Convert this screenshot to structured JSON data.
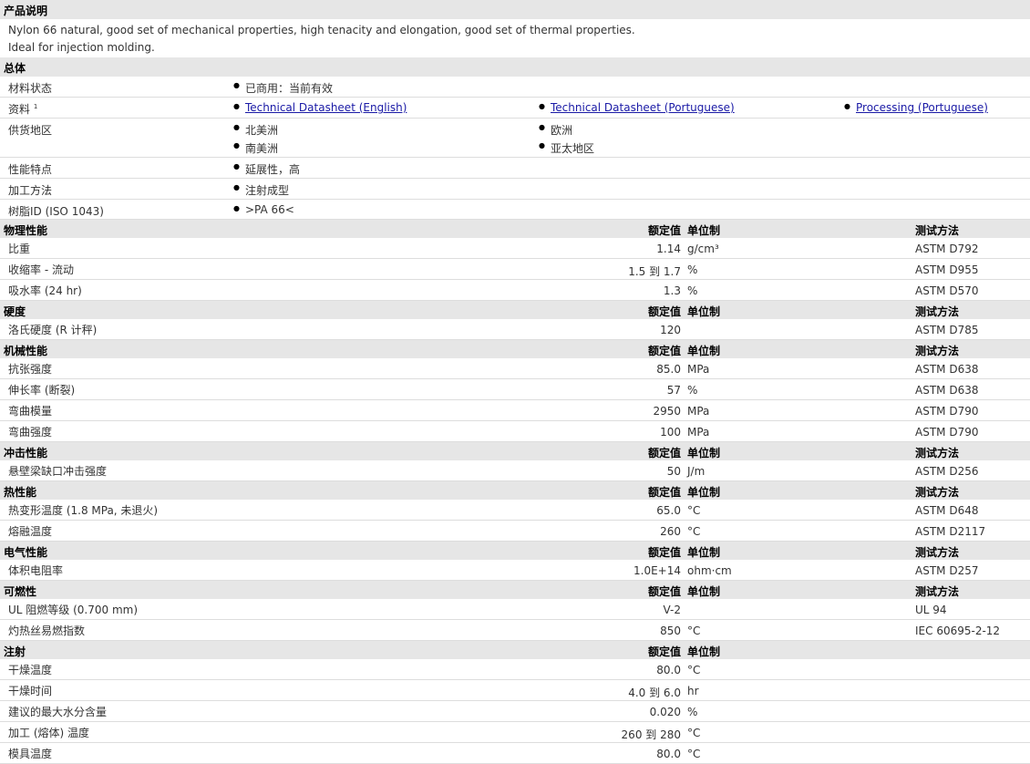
{
  "sections": {
    "desc": {
      "title": "产品说明",
      "lines": [
        "Nylon 66 natural, good set of mechanical properties, high tenacity and elongation, good set of thermal properties.",
        "Ideal for injection molding."
      ]
    },
    "general": {
      "title": "总体"
    },
    "physical": {
      "title": "物理性能"
    },
    "hardness": {
      "title": "硬度"
    },
    "mechanical": {
      "title": "机械性能"
    },
    "impact": {
      "title": "冲击性能"
    },
    "thermal": {
      "title": "热性能"
    },
    "electrical": {
      "title": "电气性能"
    },
    "flammability": {
      "title": "可燃性"
    },
    "injection": {
      "title": "注射"
    }
  },
  "headers": {
    "nominal": "额定值",
    "unit": "单位制",
    "method": "测试方法"
  },
  "general": {
    "status": {
      "label": "材料状态",
      "v1": "已商用：当前有效"
    },
    "docs": {
      "label": "资料",
      "sup": "1",
      "v1": "Technical Datasheet (English)",
      "v2": "Technical Datasheet (Portuguese)",
      "v3": "Processing (Portuguese)"
    },
    "avail": {
      "label": "供货地区",
      "v1": "北美洲",
      "v2": "欧洲",
      "v3": "南美洲",
      "v4": "亚太地区"
    },
    "features": {
      "label": "性能特点",
      "v1": "延展性，高"
    },
    "process": {
      "label": "加工方法",
      "v1": "注射成型"
    },
    "resin": {
      "label": "树脂ID (ISO 1043)",
      "v1": ">PA 66<"
    }
  },
  "physical": [
    {
      "label": "比重",
      "nominal": "1.14",
      "unit": "g/cm³",
      "method": "ASTM D792"
    },
    {
      "label": "收缩率 - 流动",
      "nominal": "1.5 到  1.7",
      "unit": "%",
      "method": "ASTM D955"
    },
    {
      "label": "吸水率 (24 hr)",
      "nominal": "1.3",
      "unit": "%",
      "method": "ASTM D570"
    }
  ],
  "hardness": [
    {
      "label": "洛氏硬度 (R 计秤)",
      "nominal": "120",
      "unit": "",
      "method": "ASTM D785"
    }
  ],
  "mechanical": [
    {
      "label": "抗张强度",
      "nominal": "85.0",
      "unit": "MPa",
      "method": "ASTM D638"
    },
    {
      "label": "伸长率 (断裂)",
      "nominal": "57",
      "unit": "%",
      "method": "ASTM D638"
    },
    {
      "label": "弯曲模量",
      "nominal": "2950",
      "unit": "MPa",
      "method": "ASTM D790"
    },
    {
      "label": "弯曲强度",
      "nominal": "100",
      "unit": "MPa",
      "method": "ASTM D790"
    }
  ],
  "impact": [
    {
      "label": "悬壁梁缺口冲击强度",
      "nominal": "50",
      "unit": "J/m",
      "method": "ASTM D256"
    }
  ],
  "thermal": [
    {
      "label": "热变形温度 (1.8 MPa, 未退火)",
      "nominal": "65.0",
      "unit": "°C",
      "method": "ASTM D648"
    },
    {
      "label": "熔融温度",
      "nominal": "260",
      "unit": "°C",
      "method": "ASTM D2117"
    }
  ],
  "electrical": [
    {
      "label": "体积电阻率",
      "nominal": "1.0E+14",
      "unit": "ohm·cm",
      "method": "ASTM D257"
    }
  ],
  "flammability": [
    {
      "label": "UL 阻燃等级 (0.700 mm)",
      "nominal": "V-2",
      "unit": "",
      "method": "UL 94"
    },
    {
      "label": "灼热丝易燃指数",
      "nominal": "850",
      "unit": "°C",
      "method": "IEC 60695-2-12"
    }
  ],
  "injection": [
    {
      "label": "干燥温度",
      "nominal": "80.0",
      "unit": "°C",
      "method": ""
    },
    {
      "label": "干燥时间",
      "nominal": "4.0 到  6.0",
      "unit": "hr",
      "method": ""
    },
    {
      "label": "建议的最大水分含量",
      "nominal": "0.020",
      "unit": "%",
      "method": ""
    },
    {
      "label": "加工 (熔体) 温度",
      "nominal": "260 到  280",
      "unit": "°C",
      "method": ""
    },
    {
      "label": "模具温度",
      "nominal": "80.0",
      "unit": "°C",
      "method": ""
    }
  ]
}
